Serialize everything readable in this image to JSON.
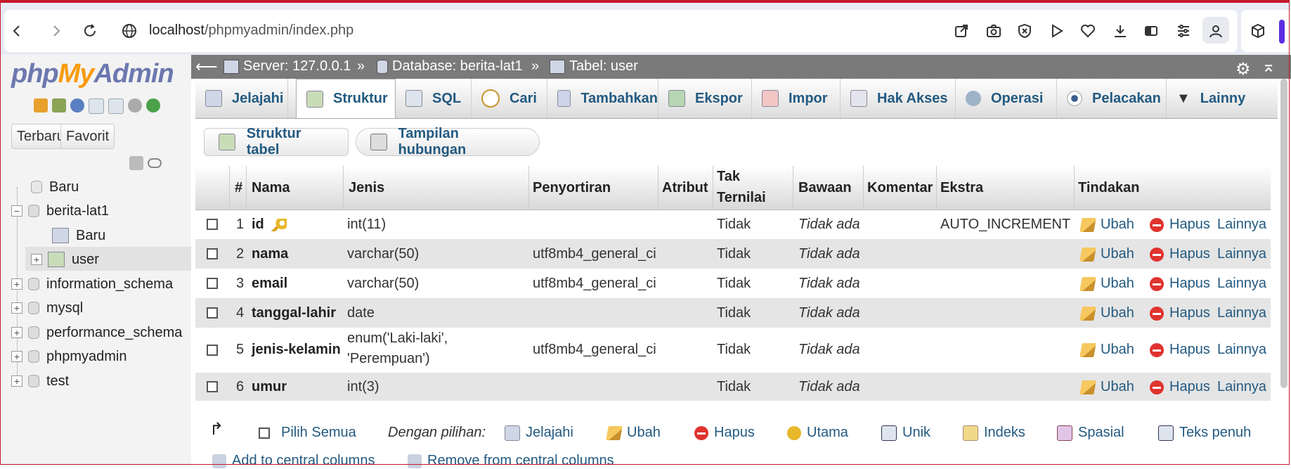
{
  "browser": {
    "url_host": "localhost",
    "url_path": "/phpmyadmin/index.php"
  },
  "sidebar": {
    "logo": {
      "php": "php",
      "my": "My",
      "admin": "Admin"
    },
    "buttons": [
      "Terbaru",
      "Favorit"
    ],
    "tree": [
      {
        "label": "Baru",
        "level": 1
      },
      {
        "label": "berita-lat1",
        "level": 0
      },
      {
        "label": "Baru",
        "level": 2
      },
      {
        "label": "user",
        "level": 2
      },
      {
        "label": "information_schema",
        "level": 0
      },
      {
        "label": "mysql",
        "level": 0
      },
      {
        "label": "performance_schema",
        "level": 0
      },
      {
        "label": "phpmyadmin",
        "level": 0
      },
      {
        "label": "test",
        "level": 0
      }
    ]
  },
  "breadcrumb": {
    "server": "Server: 127.0.0.1",
    "database": "Database: berita-lat1",
    "table": "Tabel: user",
    "sep": "»"
  },
  "tabs": [
    "Jelajahi",
    "Struktur",
    "SQL",
    "Cari",
    "Tambahkan",
    "Ekspor",
    "Impor",
    "Hak Akses",
    "Operasi",
    "Pelacakan",
    "Lainny"
  ],
  "active_tab": "Struktur",
  "subtabs": [
    "Struktur tabel",
    "Tampilan hubungan"
  ],
  "table": {
    "headers": {
      "num": "#",
      "name": "Nama",
      "type": "Jenis",
      "collation": "Penyortiran",
      "attributes": "Atribut",
      "null1": "Tak",
      "null2": "Ternilai",
      "default": "Bawaan",
      "comment": "Komentar",
      "extra": "Ekstra",
      "action": "Tindakan"
    },
    "rows": [
      {
        "num": "1",
        "name": "id",
        "type1": "int(11)",
        "type2": "",
        "collation": "",
        "null": "Tidak",
        "default": "Tidak ada",
        "extra": "AUTO_INCREMENT"
      },
      {
        "num": "2",
        "name": "nama",
        "type1": "varchar(50)",
        "type2": "",
        "collation": "utf8mb4_general_ci",
        "null": "Tidak",
        "default": "Tidak ada",
        "extra": ""
      },
      {
        "num": "3",
        "name": "email",
        "type1": "varchar(50)",
        "type2": "",
        "collation": "utf8mb4_general_ci",
        "null": "Tidak",
        "default": "Tidak ada",
        "extra": ""
      },
      {
        "num": "4",
        "name": "tanggal-lahir",
        "type1": "date",
        "type2": "",
        "collation": "",
        "null": "Tidak",
        "default": "Tidak ada",
        "extra": ""
      },
      {
        "num": "5",
        "name": "jenis-kelamin",
        "type1": "enum('Laki-laki',",
        "type2": "'Perempuan')",
        "collation": "utf8mb4_general_ci",
        "null": "Tidak",
        "default": "Tidak ada",
        "extra": ""
      },
      {
        "num": "6",
        "name": "umur",
        "type1": "int(3)",
        "type2": "",
        "collation": "",
        "null": "Tidak",
        "default": "Tidak ada",
        "extra": ""
      }
    ],
    "actions": {
      "edit": "Ubah",
      "drop": "Hapus",
      "more": "Lainnya"
    }
  },
  "footer": {
    "select_all": "Pilih Semua",
    "with_selected": "Dengan pilihan:",
    "items": [
      "Jelajahi",
      "Ubah",
      "Hapus",
      "Utama",
      "Unik",
      "Indeks",
      "Spasial",
      "Teks penuh"
    ],
    "central": [
      "Add to central columns",
      "Remove from central columns"
    ]
  },
  "colors": {
    "link": "#235a81",
    "logo_blue": "#6c78af",
    "logo_orange": "#f89c0e",
    "bar": "#7a7a7a",
    "accent": "#5b2fe0"
  },
  "icons": [
    "back-icon",
    "forward-icon",
    "reload-icon",
    "site-info-icon",
    "share-icon",
    "camera-icon",
    "shield-icon",
    "play-icon",
    "heart-icon",
    "download-icon",
    "reader-icon",
    "settings-icon",
    "profile-icon",
    "extensions-icon"
  ]
}
